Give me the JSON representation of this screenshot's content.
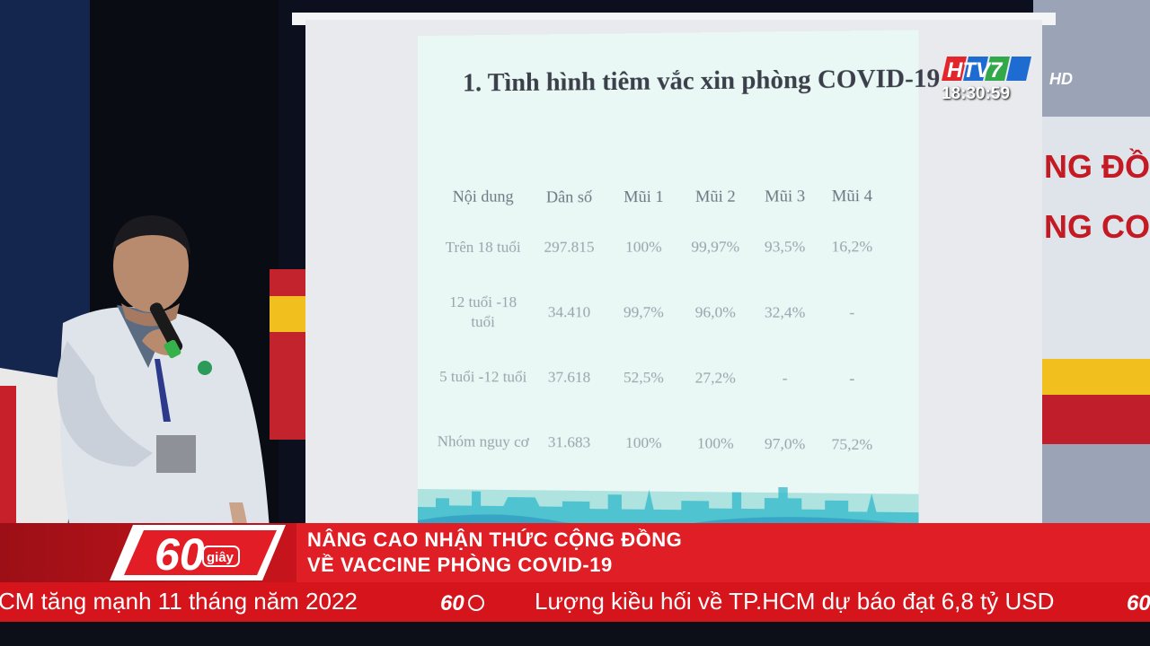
{
  "slide": {
    "title": "1. Tình hình tiêm vắc xin phòng COVID-19",
    "table": {
      "headers": [
        "Nội dung",
        "Dân số",
        "Mũi 1",
        "Mũi 2",
        "Mũi 3",
        "Mũi 4"
      ],
      "rows": [
        [
          "Trên 18 tuổi",
          "297.815",
          "100%",
          "99,97%",
          "93,5%",
          "16,2%"
        ],
        [
          "12 tuổi -18 tuổi",
          "34.410",
          "99,7%",
          "96,0%",
          "32,4%",
          "-"
        ],
        [
          "5 tuổi -12 tuổi",
          "37.618",
          "52,5%",
          "27,2%",
          "-",
          "-"
        ],
        [
          "Nhóm nguy cơ",
          "31.683",
          "100%",
          "100%",
          "97,0%",
          "75,2%"
        ]
      ]
    }
  },
  "background_banner": {
    "line1": "NG ĐỒNG",
    "line2": "NG COVID"
  },
  "channel": {
    "logo_text": "HTV7",
    "hd_label": "HD",
    "clock": "18:30:59"
  },
  "program": {
    "logo_number": "60",
    "logo_word": "giây"
  },
  "headline": {
    "line1": "NÂNG CAO NHẬN THỨC CỘNG ĐỒNG",
    "line2": "VỀ VACCINE PHÒNG COVID-19"
  },
  "ticker": {
    "item1": "CM tăng mạnh 11 tháng năm 2022",
    "item2": "Lượng kiều hối về TP.HCM dự báo đạt 6,8 tỷ USD"
  },
  "colors": {
    "lower_third_red": "#e01e25",
    "ticker_red": "#d6141c",
    "slide_background": "#e9f8f5"
  }
}
